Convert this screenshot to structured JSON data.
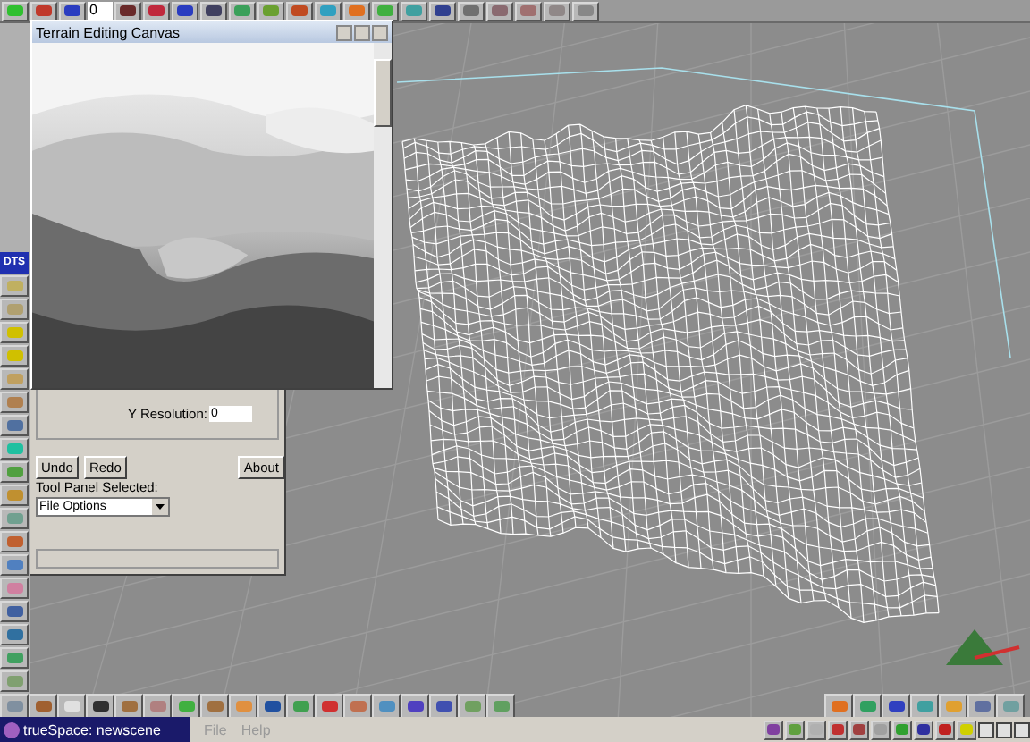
{
  "toolbar": {
    "frame_field": "0"
  },
  "canvas_window": {
    "title": "Terrain Editing Canvas"
  },
  "left_toolbar": {
    "label": "DTS"
  },
  "panel": {
    "y_resolution_label": "Y Resolution:",
    "y_resolution_value": "0",
    "buttons": [
      "Undo",
      "Redo",
      "About"
    ],
    "tool_panel_label": "Tool Panel Selected:",
    "tool_panel_value": "File Options"
  },
  "taskbar": {
    "title": "trueSpace: newscene",
    "menu": [
      {
        "label": "File",
        "disabled": true
      },
      {
        "label": "Help",
        "disabled": true
      }
    ]
  }
}
